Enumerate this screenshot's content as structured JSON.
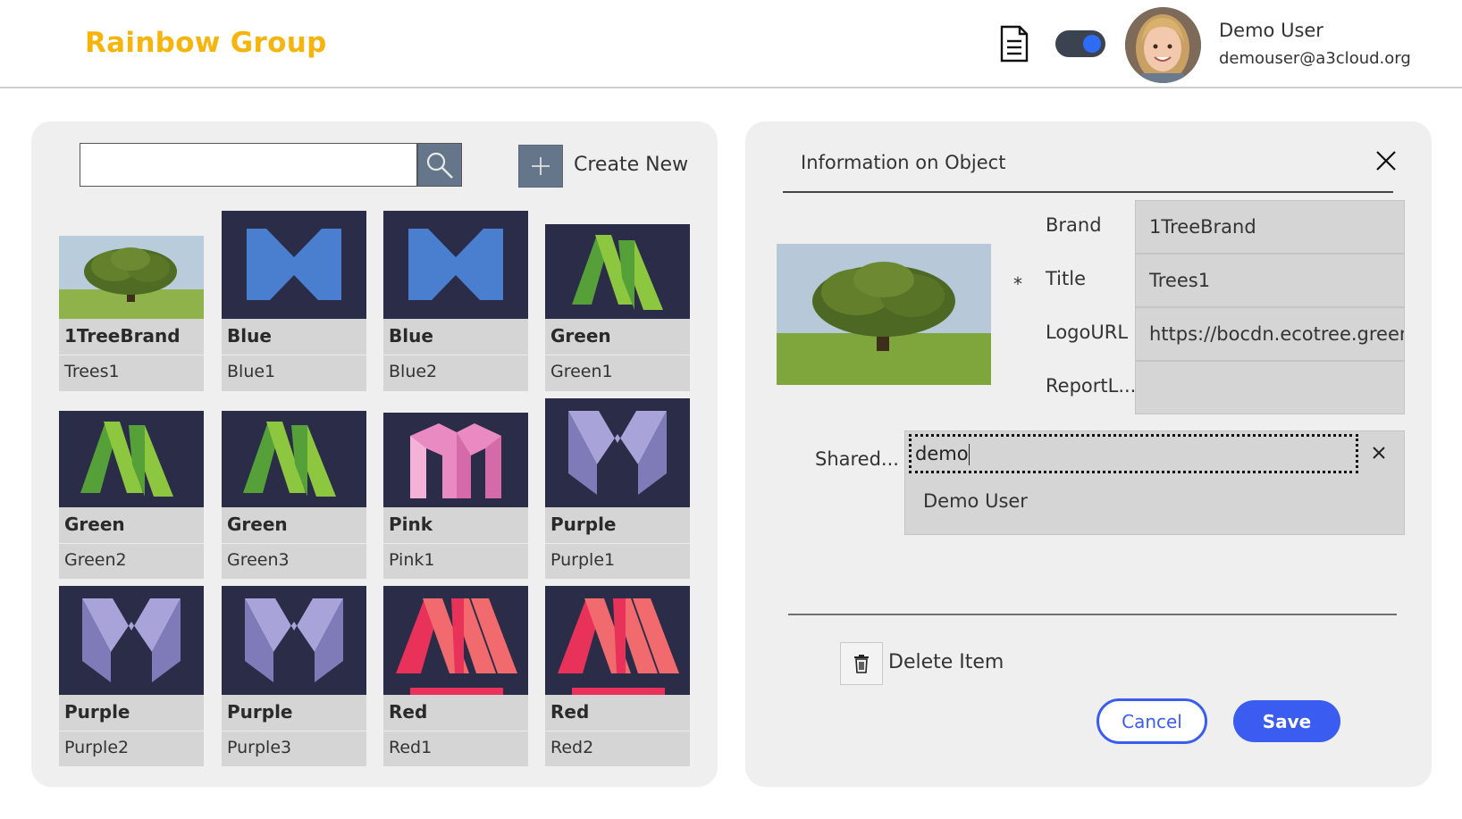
{
  "header": {
    "app_title": "Rainbow Group",
    "user_name": "Demo User",
    "user_email": "demouser@a3cloud.org"
  },
  "gallery": {
    "search_value": "",
    "create_label": "Create New",
    "items": [
      {
        "brand": "1TreeBrand",
        "title": "Trees1",
        "logo": "tree-photo"
      },
      {
        "brand": "Blue",
        "title": "Blue1",
        "logo": "blue-v-logo"
      },
      {
        "brand": "Blue",
        "title": "Blue2",
        "logo": "blue-v-logo"
      },
      {
        "brand": "Green",
        "title": "Green1",
        "logo": "green-m-logo"
      },
      {
        "brand": "Green",
        "title": "Green2",
        "logo": "green-m-logo"
      },
      {
        "brand": "Green",
        "title": "Green3",
        "logo": "green-m-logo"
      },
      {
        "brand": "Pink",
        "title": "Pink1",
        "logo": "pink-m-logo"
      },
      {
        "brand": "Purple",
        "title": "Purple1",
        "logo": "purple-m-logo"
      },
      {
        "brand": "Purple",
        "title": "Purple2",
        "logo": "purple-m-logo"
      },
      {
        "brand": "Purple",
        "title": "Purple3",
        "logo": "purple-m-logo"
      },
      {
        "brand": "Red",
        "title": "Red1",
        "logo": "red-m-logo"
      },
      {
        "brand": "Red",
        "title": "Red2",
        "logo": "red-m-logo"
      }
    ]
  },
  "details": {
    "title": "Information on Object",
    "brand_label": "Brand",
    "brand_value": "1TreeBrand",
    "required_marker": "*",
    "title_label": "Title",
    "title_value": "Trees1",
    "logo_label": "LogoURL",
    "logo_value": "https://bocdn.ecotree.green/",
    "report_label": "ReportL...",
    "report_value": "",
    "shared_label": "Shared...",
    "shared_input": "demo",
    "shared_option": "Demo User",
    "delete_label": "Delete Item",
    "cancel_label": "Cancel",
    "save_label": "Save"
  },
  "colors": {
    "brand_title": "#f5b50d",
    "accent": "#3a5cf0",
    "tile_bg": "#2b2c47",
    "panel_bg": "#efefef"
  }
}
